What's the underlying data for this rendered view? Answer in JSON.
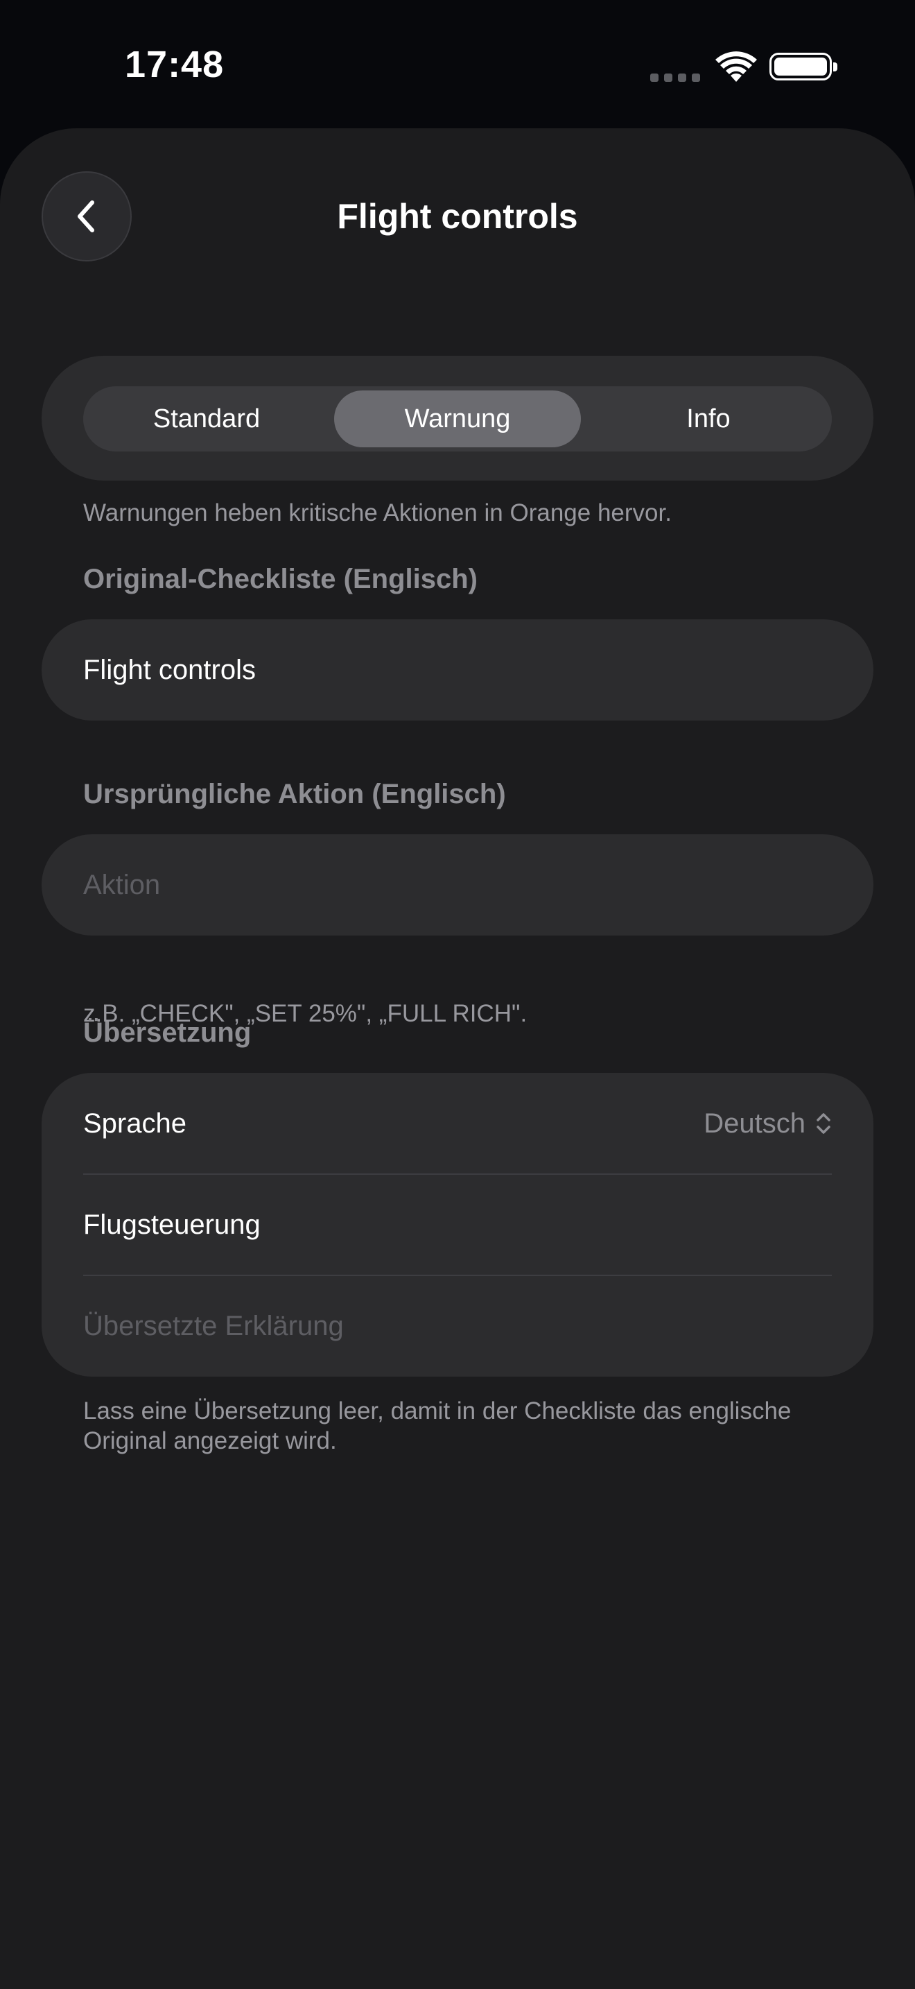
{
  "status_bar": {
    "time": "17:48"
  },
  "nav": {
    "title": "Flight controls"
  },
  "segmented": {
    "items": [
      "Standard",
      "Warnung",
      "Info"
    ],
    "selected": "Warnung"
  },
  "style_hint": "Warnungen heben kritische Aktionen in Orange hervor.",
  "original_checklist": {
    "header": "Original-Checkliste (Englisch)",
    "value": "Flight controls"
  },
  "original_action": {
    "header": "Ursprüngliche Aktion (Englisch)",
    "placeholder": "Aktion",
    "hint": "z.B. „CHECK\", „SET 25%\", „FULL RICH\"."
  },
  "translation": {
    "header": "Übersetzung",
    "language_label": "Sprache",
    "language_value": "Deutsch",
    "title_value": "Flugsteuerung",
    "explanation_placeholder": "Übersetzte Erklärung",
    "hint": "Lass eine Übersetzung leer, damit in der Checkliste das englische Original angezeigt wird."
  },
  "colors": {
    "background": "#1c1c1e",
    "card": "#2c2c2e",
    "segment_active": "#6b6b70",
    "secondary_text": "#8e8e93"
  },
  "icons": [
    "chevron-left-icon",
    "wifi-icon",
    "battery-icon",
    "signal-dots-icon",
    "chevron-up-down-icon"
  ]
}
